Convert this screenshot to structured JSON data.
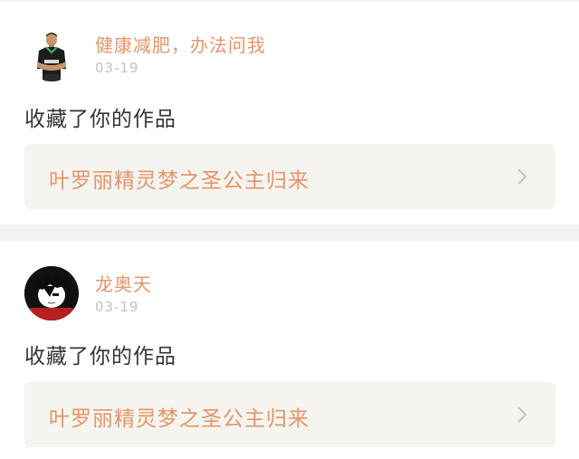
{
  "feed": [
    {
      "username": "健康减肥，办法问我",
      "date": "03-19",
      "action": "收藏了你的作品",
      "work_title": "叶罗丽精灵梦之圣公主归来"
    },
    {
      "username": "龙奥天",
      "date": "03-19",
      "action": "收藏了你的作品",
      "work_title": "叶罗丽精灵梦之圣公主归来"
    }
  ],
  "colors": {
    "accent": "#e3956a",
    "date": "#c2c2c2",
    "text": "#333333",
    "box_bg": "#f5f4ef",
    "divider": "#f2f2f2"
  },
  "icons": {
    "chevron": "chevron-right-icon"
  }
}
